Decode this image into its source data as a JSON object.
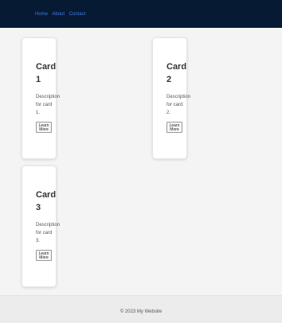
{
  "header": {
    "nav": [
      "Home",
      "About",
      "Contact"
    ]
  },
  "cards": [
    {
      "title": "Card 1",
      "description": "Description for card 1.",
      "button": "Learn More"
    },
    {
      "title": "Card 2",
      "description": "Description for card 2.",
      "button": "Learn More"
    },
    {
      "title": "Card 3",
      "description": "Description for card 3.",
      "button": "Learn More"
    }
  ],
  "footer": {
    "copyright": "© 2023 My Website"
  },
  "colors": {
    "header_bg": "#071a33",
    "nav_link": "#3f7be6",
    "page_bg": "#f4f4f4",
    "card_bg": "#ffffff"
  }
}
